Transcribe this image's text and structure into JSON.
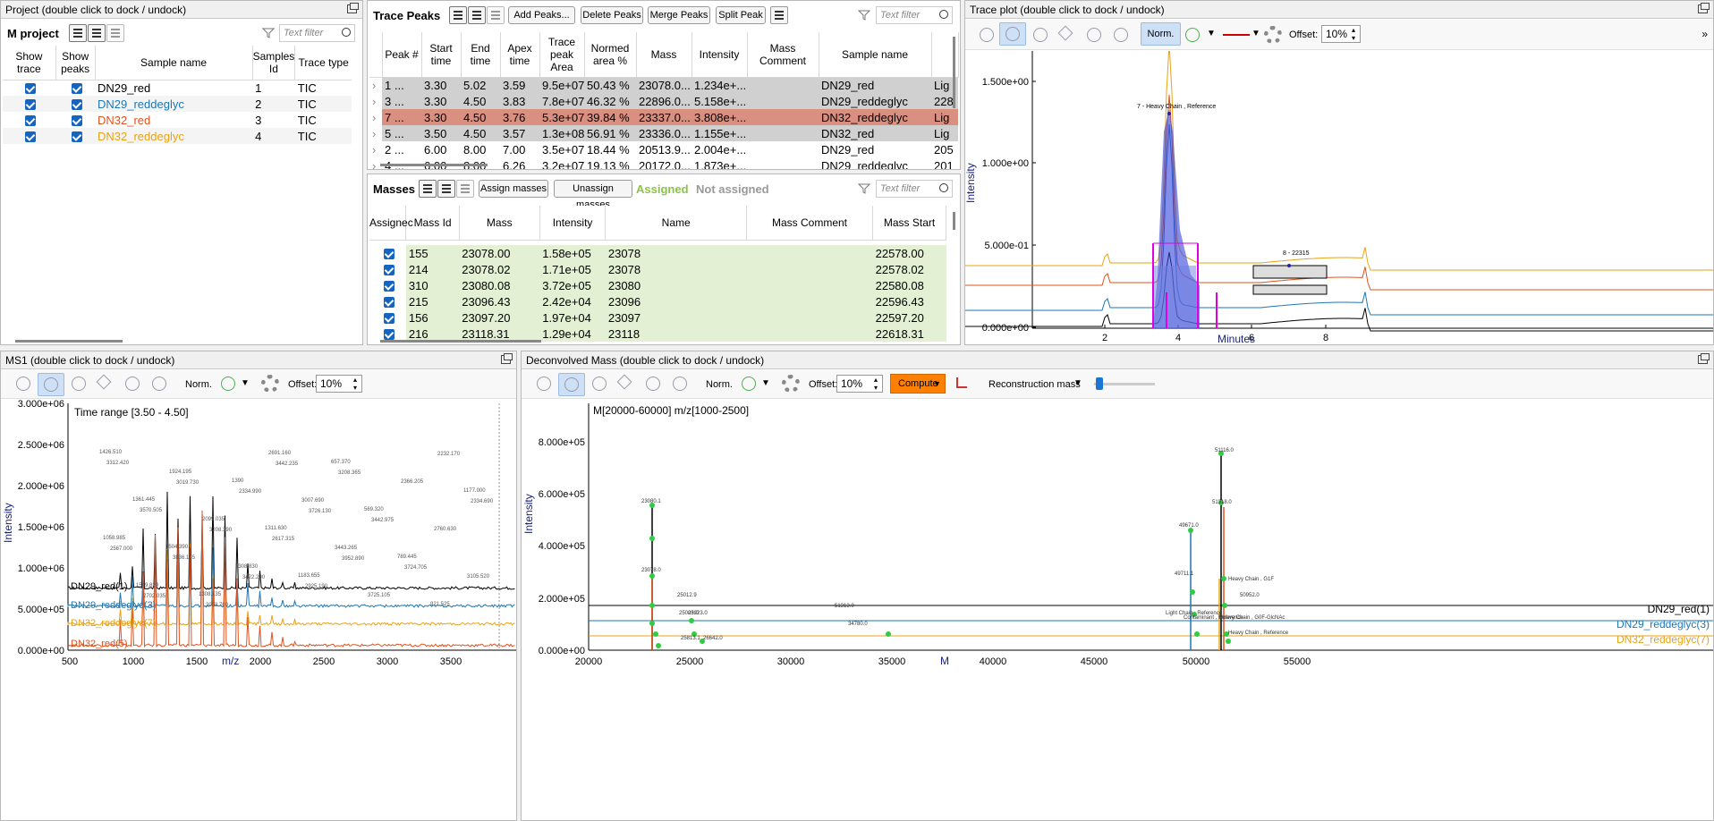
{
  "project": {
    "title": "Project (double click to dock / undock)",
    "heading": "M project",
    "filter_placeholder": "Text filter",
    "columns": [
      "Show trace",
      "Show peaks",
      "Sample name",
      "Samples Id",
      "Trace type"
    ],
    "rows": [
      {
        "name": "DN29_red",
        "id": "1",
        "type": "TIC",
        "color": "#000000"
      },
      {
        "name": "DN29_reddeglyc",
        "id": "2",
        "type": "TIC",
        "color": "#1f77b4"
      },
      {
        "name": "DN32_red",
        "id": "3",
        "type": "TIC",
        "color": "#e0531f"
      },
      {
        "name": "DN32_reddeglyc",
        "id": "4",
        "type": "TIC",
        "color": "#e8a317"
      }
    ]
  },
  "peaks": {
    "title": "Trace Peaks",
    "buttons": [
      "Add Peaks...",
      "Delete Peaks",
      "Merge Peaks",
      "Split Peak"
    ],
    "filter_placeholder": "Text filter",
    "columns": [
      "Peak #",
      "Start time",
      "End time",
      "Apex time",
      "Trace peak Area",
      "Normed area %",
      "Mass",
      "Intensity",
      "Mass Comment",
      "Sample name",
      ""
    ],
    "rows": [
      [
        "1 ...",
        "3.30",
        "5.02",
        "3.59",
        "9.5e+07",
        "50.43 %",
        "23078.0...",
        "1.234e+...",
        "",
        "DN29_red",
        "Lig"
      ],
      [
        "3 ...",
        "3.30",
        "4.50",
        "3.83",
        "7.8e+07",
        "46.32 %",
        "22896.0...",
        "5.158e+...",
        "",
        "DN29_reddeglyc",
        "228"
      ],
      [
        "7 ...",
        "3.30",
        "4.50",
        "3.76",
        "5.3e+07",
        "39.84 %",
        "23337.0...",
        "3.808e+...",
        "",
        "DN32_reddeglyc",
        "Lig"
      ],
      [
        "5 ...",
        "3.50",
        "4.50",
        "3.57",
        "1.3e+08",
        "56.91 %",
        "23336.0...",
        "1.155e+...",
        "",
        "DN32_red",
        "Lig"
      ],
      [
        "2 ...",
        "6.00",
        "8.00",
        "7.00",
        "3.5e+07",
        "18.44 %",
        "20513.9...",
        "2.004e+...",
        "",
        "DN29_red",
        "205"
      ],
      [
        "4 ...",
        "6.00",
        "8.00",
        "6.26",
        "3.2e+07",
        "19.13 %",
        "20172.0...",
        "1.873e+...",
        "",
        "DN29_reddeglyc",
        "201"
      ]
    ]
  },
  "masses": {
    "title": "Masses",
    "assign": "Assign masses",
    "unassign": "Unassign masses",
    "assigned": "Assigned",
    "not_assigned": "Not assigned",
    "filter_placeholder": "Text filter",
    "columns": [
      "Assignec",
      "Mass Id",
      "Mass",
      "Intensity",
      "Name",
      "Mass Comment",
      "Mass Start"
    ],
    "rows": [
      [
        "155",
        "23078.00",
        "1.58e+05",
        "23078",
        "",
        "22578.00"
      ],
      [
        "214",
        "23078.02",
        "1.71e+05",
        "23078",
        "",
        "22578.02"
      ],
      [
        "310",
        "23080.08",
        "3.72e+05",
        "23080",
        "",
        "22580.08"
      ],
      [
        "215",
        "23096.43",
        "2.42e+04",
        "23096",
        "",
        "22596.43"
      ],
      [
        "156",
        "23097.20",
        "1.97e+04",
        "23097",
        "",
        "22597.20"
      ],
      [
        "216",
        "23118.31",
        "1.29e+04",
        "23118",
        "",
        "22618.31"
      ]
    ]
  },
  "trace": {
    "title": "Trace plot (double click to dock / undock)",
    "norm": "Norm.",
    "offset_label": "Offset:",
    "offset": "10%",
    "xlabel": "Minutes",
    "ylabel": "Intensity",
    "yticks": [
      "1.500e+00",
      "1.000e+00",
      "5.000e-01",
      "0.000e+00"
    ],
    "xticks": [
      "2",
      "4",
      "6",
      "8"
    ],
    "ann1": "7 - Heavy Chain , Reference",
    "ann2": "8 - 22315"
  },
  "ms1": {
    "title": "MS1 (double click to dock / undock)",
    "norm": "Norm.",
    "offset_label": "Offset:",
    "offset": "10%",
    "range": "Time range [3.50 - 4.50]",
    "ylabel": "Intensity",
    "xlabel": "m/z",
    "yticks": [
      "3.000e+06",
      "2.500e+06",
      "2.000e+06",
      "1.500e+06",
      "1.000e+06",
      "5.000e+05",
      "0.000e+00"
    ],
    "xticks": [
      "500",
      "1000",
      "1500",
      "2000",
      "2500",
      "3000",
      "3500"
    ],
    "legend": [
      {
        "name": "DN29_red(1)",
        "color": "#000000"
      },
      {
        "name": "DN29_reddeglyc(3)",
        "color": "#1f77b4"
      },
      {
        "name": "DN32_reddeglyc(7)",
        "color": "#e8a317"
      },
      {
        "name": "DN32_red(5)",
        "color": "#e0531f"
      }
    ],
    "peaklabels": [
      "1426.510",
      "1361.445",
      "1504.390",
      "1308.135",
      "1390",
      "1311.630",
      "1183.655",
      "657.370",
      "569.320",
      "789.445",
      "921.525",
      "1177.000",
      "1058.985",
      "1549.820",
      "1924.195",
      "2099.035",
      "2308.830",
      "2691.160",
      "3007.690",
      "3443.265",
      "3725.105",
      "2366.205",
      "2760.630",
      "3105.520",
      "3312.420",
      "3570.505",
      "3836.135",
      "2053.700",
      "2334.990",
      "2617.315",
      "2925.190",
      "3208.365",
      "3442.975",
      "3724.705",
      "2232.170",
      "2334.690",
      "2567.000",
      "2702.035",
      "3019.730",
      "3208.390",
      "3422.200",
      "3442.235",
      "3726.130",
      "3952.890"
    ]
  },
  "decon": {
    "title": "Deconvolved Mass (double click to dock / undock)",
    "norm": "Norm.",
    "offset_label": "Offset:",
    "offset": "10%",
    "compute": "Compute",
    "recon": "Reconstruction mass",
    "range": "M[20000-60000] m/z[1000-2500]",
    "ylabel": "Intensity",
    "xlabel": "M",
    "yticks": [
      "8.000e+05",
      "6.000e+05",
      "4.000e+05",
      "2.000e+05",
      "0.000e+00"
    ],
    "xticks": [
      "20000",
      "25000",
      "30000",
      "35000",
      "40000",
      "45000",
      "50000",
      "55000"
    ],
    "legend": [
      {
        "name": "DN29_red(1)",
        "color": "#000000"
      },
      {
        "name": "DN29_reddeglyc(3)",
        "color": "#1f77b4"
      },
      {
        "name": "DN32_reddeglyc(7)",
        "color": "#e8a317"
      }
    ],
    "labels": [
      "23080.1",
      "23078.0",
      "25012.9",
      "25003.0",
      "25923.0",
      "25813.1",
      "26642.0",
      "34780.0",
      "49671.0",
      "51116.0",
      "51318.0",
      "Heavy Chain , G1F",
      "Heavy Chain , Reference",
      "Light Chain , Reference",
      "Contaminant , Reference",
      "Heavy Chain , G0F-GlcNAc",
      "50952.0",
      "51313.0",
      "49711.1"
    ]
  }
}
